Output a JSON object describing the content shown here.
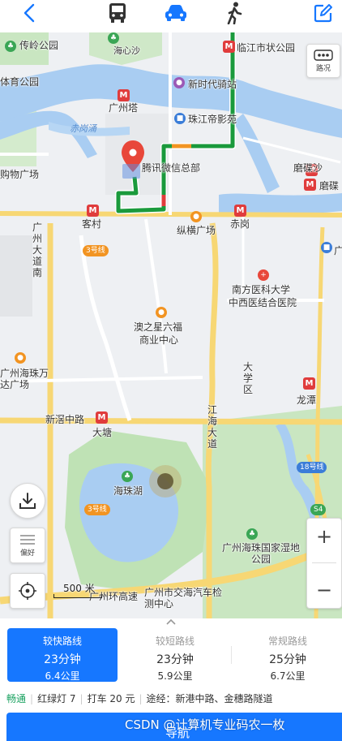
{
  "topbar": {
    "back_icon": "chevron-left-icon",
    "modes": [
      "bus-icon",
      "car-icon",
      "walk-icon"
    ],
    "active_mode": "car-icon",
    "edit_icon": "edit-icon",
    "accent": "#1677ff"
  },
  "map": {
    "labels": {
      "chuanling_park": "传岭公园",
      "haixinsha": "海心沙",
      "linjiang_stop": "临江市状公园",
      "sports_park": "体育公园",
      "canton_tower": "广州塔",
      "new_era": "新时代骑站",
      "zhujiang_cinema": "珠江帝影苑",
      "shopping": "购物广场",
      "chigang_creek": "赤岗涌",
      "tencent": "腾讯微信总部",
      "modiesha": "磨碟沙",
      "modie": "磨碟",
      "kecun": "客村",
      "chigang": "赤岗",
      "zongheng": "纵横广场",
      "guangzhou_ave": "广州大道南",
      "line3_a": "3号线",
      "nanfang": "南方医科大学",
      "nanfang2": "中西医结合医院",
      "aozhixing": "澳之星六福",
      "commerce": "商业中心",
      "haizhu_wanda": "广州海珠万达广场",
      "university": "大学区",
      "longtan": "龙潭",
      "xingang": "新滘中路",
      "datang": "大塘",
      "jianghai": "江海大道",
      "line18": "18号线",
      "haizhu_lake": "海珠湖",
      "line3_b": "3号线",
      "wetland": "广州海珠国家湿地公园",
      "s4": "S4",
      "huanwei": "广州环高速",
      "haizhu_park": "广州市交海汽车检测中心",
      "traffic": "路况",
      "preference": "偏好",
      "right_edge": "广"
    },
    "scale_label": "500 米",
    "zoom_in": "+",
    "zoom_out": "−",
    "route_color": "#1a9a3c"
  },
  "routes": [
    {
      "name": "较快路线",
      "time": "23分钟",
      "distance": "6.4公里",
      "active": true
    },
    {
      "name": "较短路线",
      "time": "23分钟",
      "distance": "5.9公里",
      "active": false
    },
    {
      "name": "常规路线",
      "time": "25分钟",
      "distance": "6.7公里",
      "active": false
    }
  ],
  "summary": {
    "status": "畅通",
    "lights": "红绿灯 7",
    "taxi": "打车 20 元",
    "via": "途经：新港中路、金穗路隧道"
  },
  "navigate_button": "导航",
  "watermark": "CSDN @计算机专业码农一枚"
}
